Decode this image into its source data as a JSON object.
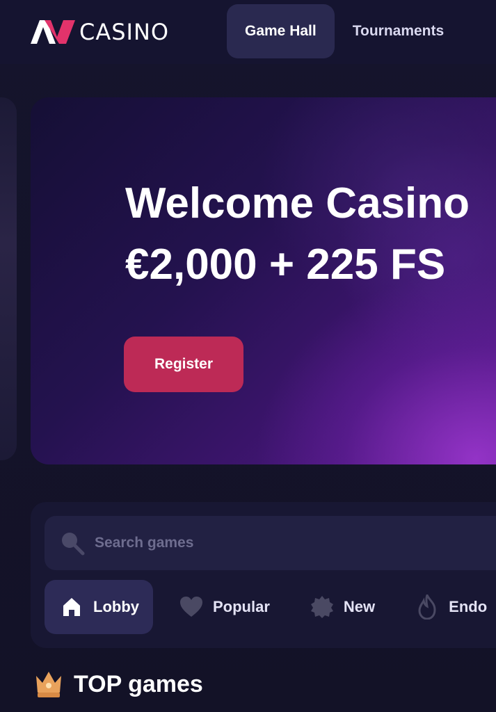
{
  "header": {
    "logo_text": "CASINO",
    "nav": [
      {
        "label": "Game Hall",
        "active": true
      },
      {
        "label": "Tournaments",
        "active": false
      }
    ]
  },
  "hero": {
    "title": "Welcome Casino",
    "subtitle": "€2,000 + 225 FS",
    "register_label": "Register"
  },
  "search": {
    "placeholder": "Search games",
    "value": ""
  },
  "categories": [
    {
      "label": "Lobby",
      "icon": "home-icon",
      "active": true
    },
    {
      "label": "Popular",
      "icon": "heart-icon",
      "active": false
    },
    {
      "label": "New",
      "icon": "new-badge-icon",
      "active": false
    },
    {
      "label": "Endo",
      "icon": "flame-icon",
      "active": false
    }
  ],
  "section": {
    "title": "TOP games",
    "icon": "crown-icon"
  },
  "colors": {
    "background": "#14132a",
    "accent_register": "#bd2a56",
    "logo_accent": "#e2336b",
    "active_tab": "#2a2950"
  }
}
